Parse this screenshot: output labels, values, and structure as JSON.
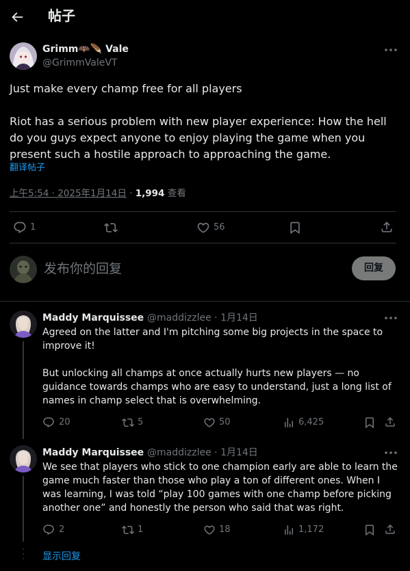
{
  "header": {
    "title": "帖子"
  },
  "post": {
    "author_name": "Grimm🦇🪶 Vale",
    "author_handle": "@GrimmValeVT",
    "text": "Just make every champ free for all players\n\nRiot has a serious problem with new player experience: How the hell do you guys expect anyone to enjoy playing the game when you present such a hostile approach to approaching the game.",
    "translate_label": "翻译帖子",
    "time": "上午5:54 · 2025年1月14日",
    "separator": " · ",
    "views_count": "1,994",
    "views_label": " 查看",
    "reply_count": "1",
    "retweet_count": "",
    "like_count": "56"
  },
  "composer": {
    "placeholder": "发布你的回复",
    "button_label": "回复"
  },
  "replies": [
    {
      "author_name": "Maddy Marquissee",
      "meta": "@maddizzlee · 1月14日",
      "text": "Agreed on the latter and I'm pitching some big projects in the space to improve it!\n\nBut unlocking all champs at once actually hurts new players — no guidance towards champs who are easy to understand, just a long list of names in champ select that is overwhelming.",
      "reply_count": "20",
      "retweet_count": "5",
      "like_count": "50",
      "views_count": "6,425"
    },
    {
      "author_name": "Maddy Marquissee",
      "meta": "@maddizzlee · 1月14日",
      "text": "We see that players who stick to one champion early are able to learn the game much faster than those who play a ton of different ones. When I was learning, I was told “play 100 games with one champ before picking another one” and honestly the person who said that was right.",
      "reply_count": "2",
      "retweet_count": "1",
      "like_count": "18",
      "views_count": "1,172"
    }
  ],
  "show_replies_label": "显示回复",
  "colors": {
    "accent": "#1d9bf0",
    "text": "#e7e9ea",
    "muted": "#71767b",
    "divider": "#2f3336",
    "reply_button_bg": "#787a7a"
  },
  "icons": [
    "back-arrow-icon",
    "more-icon",
    "reply-icon",
    "retweet-icon",
    "like-icon",
    "bookmark-icon",
    "share-icon",
    "views-icon"
  ]
}
